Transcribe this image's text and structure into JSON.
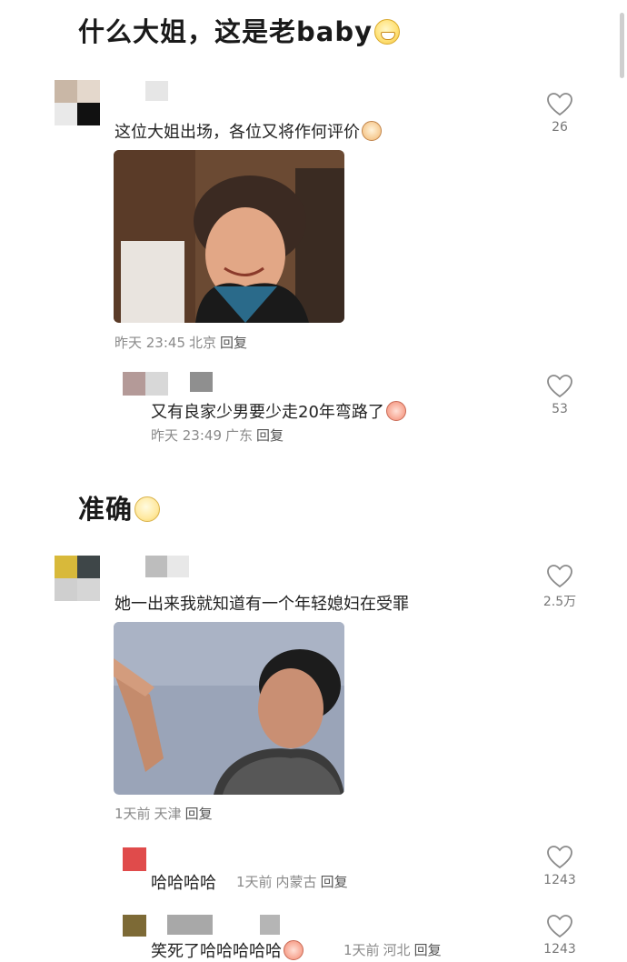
{
  "headings": {
    "first": "什么大姐，这是老baby",
    "second": "准确"
  },
  "comments": [
    {
      "text": "这位大姐出场，各位又将作何评价",
      "time": "昨天 23:45",
      "location": "北京",
      "reply": "回复",
      "likes": "26"
    },
    {
      "text": "又有良家少男要少走20年弯路了",
      "time": "昨天 23:49",
      "location": "广东",
      "reply": "回复",
      "likes": "53"
    },
    {
      "text": "她一出来我就知道有一个年轻媳妇在受罪",
      "time": "1天前",
      "location": "天津",
      "reply": "回复",
      "likes": "2.5万"
    },
    {
      "text": "哈哈哈哈",
      "time": "1天前",
      "location": "内蒙古",
      "reply": "回复",
      "likes": "1243"
    },
    {
      "text": "笑死了哈哈哈哈哈",
      "time": "1天前",
      "location": "河北",
      "reply": "回复",
      "likes": "1243"
    }
  ],
  "colors": {
    "background": "#ffffff",
    "heart_outline": "#8a8a8a",
    "meta_text": "#8a8a8a"
  },
  "icons": [
    "heart-outline-icon",
    "grin-emoji-icon",
    "shock-emoji-icon",
    "face-sticker-icon",
    "peach-sticker-icon"
  ]
}
